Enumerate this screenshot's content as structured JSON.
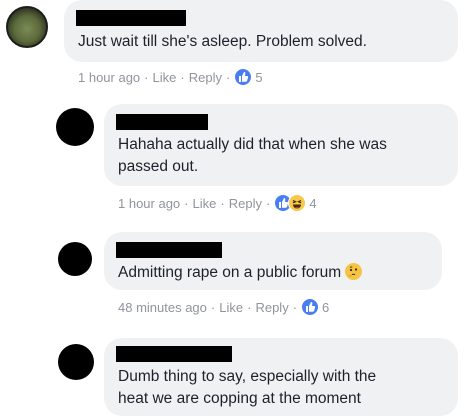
{
  "colors": {
    "bubble": "#eff1f3",
    "meta_text": "#90949c",
    "like_blue": "#4a7df0",
    "haha_yellow": "#f7c947"
  },
  "comments": [
    {
      "text": "Just wait till she's asleep. Problem solved.",
      "time": "1 hour ago",
      "like_label": "Like",
      "reply_label": "Reply",
      "reactions": [
        "like-icon"
      ],
      "count": "5",
      "redacted_name": true
    },
    {
      "text": "Hahaha actually did that when she was\npassed out.",
      "time": "1 hour ago",
      "like_label": "Like",
      "reply_label": "Reply",
      "reactions": [
        "like-icon",
        "haha-icon"
      ],
      "count": "4",
      "redacted_name": true
    },
    {
      "text": "Admitting rape on a public forum",
      "trailing_emoji": "thinking-face-icon",
      "time": "48 minutes ago",
      "like_label": "Like",
      "reply_label": "Reply",
      "reactions": [
        "like-icon"
      ],
      "count": "6",
      "redacted_name": true
    },
    {
      "text": "Dumb thing to say, especially with the\nheat we are copping at the moment",
      "redacted_name": true
    }
  ],
  "separators": {
    "dot": "·"
  }
}
